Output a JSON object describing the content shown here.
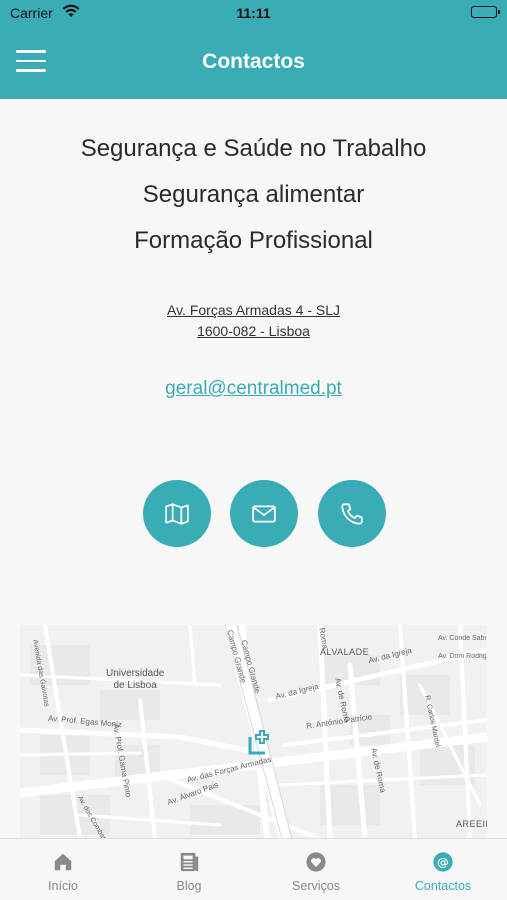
{
  "status_bar": {
    "carrier": "Carrier",
    "time": "11:11"
  },
  "header": {
    "title": "Contactos"
  },
  "services": [
    "Segurança e Saúde no Trabalho",
    "Segurança alimentar",
    "Formação Profissional"
  ],
  "address": {
    "line1": "Av. Forças Armadas 4 - SLJ",
    "line2": "1600-082 - Lisboa"
  },
  "email": "geral@centralmed.pt",
  "action_buttons": [
    "map-icon",
    "mail-icon",
    "phone-icon"
  ],
  "map": {
    "labels": {
      "alvalade": "ALVALADE",
      "universidade": "Universidade\nde Lisboa",
      "egas_moniz": "Av. Prof. Egas Moniz",
      "gama_pinto": "Av. Prof. Gama Pinto",
      "forcas_armadas": "Av. das Forças Armadas",
      "alvaro_pais": "Av. Álvaro Pais",
      "igreja_1": "Av. da Igreja",
      "igreja_2": "Av. da Igreja",
      "roma_1": "Av. de Roma",
      "roma_2": "Av. de Roma",
      "campo_grande_1": "Campo Grande",
      "campo_grande_2": "Campo Grande",
      "antonio_patricio": "R. António Patrício",
      "areeiro": "AREEIR",
      "conde": "Av. Conde Sabugosa",
      "dom_rodrigo": "Av. Dom Rodrigo",
      "carlos_mardel": "R. Carlos Mardel",
      "roma_top": "Roma",
      "gulbenkian": "Avenida das Gaivotas",
      "combatentes": "Av. dos Combatentes"
    }
  },
  "tabs": [
    {
      "label": "Início",
      "icon": "home-icon",
      "active": false
    },
    {
      "label": "Blog",
      "icon": "newspaper-icon",
      "active": false
    },
    {
      "label": "Serviços",
      "icon": "heart-icon",
      "active": false
    },
    {
      "label": "Contactos",
      "icon": "at-icon",
      "active": true
    }
  ],
  "colors": {
    "accent": "#3aacb6",
    "background": "#f7f7f7",
    "inactive": "#8a8a8a"
  }
}
